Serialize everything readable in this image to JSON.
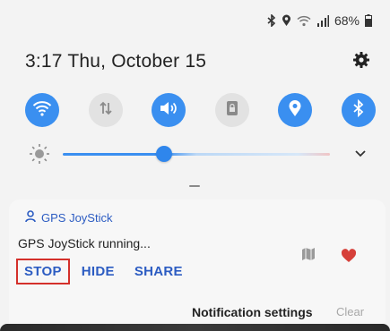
{
  "status_bar": {
    "battery_text": "68%"
  },
  "header": {
    "time": "3:17",
    "date": "Thu, October 15"
  },
  "quick_settings": {
    "tiles": [
      {
        "icon": "wifi-icon",
        "on": true
      },
      {
        "icon": "mobile-data-icon",
        "on": false
      },
      {
        "icon": "sound-icon",
        "on": true
      },
      {
        "icon": "rotation-lock-icon",
        "on": false
      },
      {
        "icon": "location-icon",
        "on": true
      },
      {
        "icon": "bluetooth-icon",
        "on": true
      }
    ],
    "brightness_level": 0.38
  },
  "notification": {
    "app_name": "GPS JoyStick",
    "text": "GPS JoyStick running...",
    "actions": {
      "stop": "STOP",
      "hide": "HIDE",
      "share": "SHARE"
    }
  },
  "footer": {
    "settings_label": "Notification settings",
    "clear_label": "Clear"
  },
  "colors": {
    "accent": "#3a8ff0",
    "link": "#2c5cc2",
    "highlight_border": "#d4302b",
    "heart": "#d6403a"
  }
}
